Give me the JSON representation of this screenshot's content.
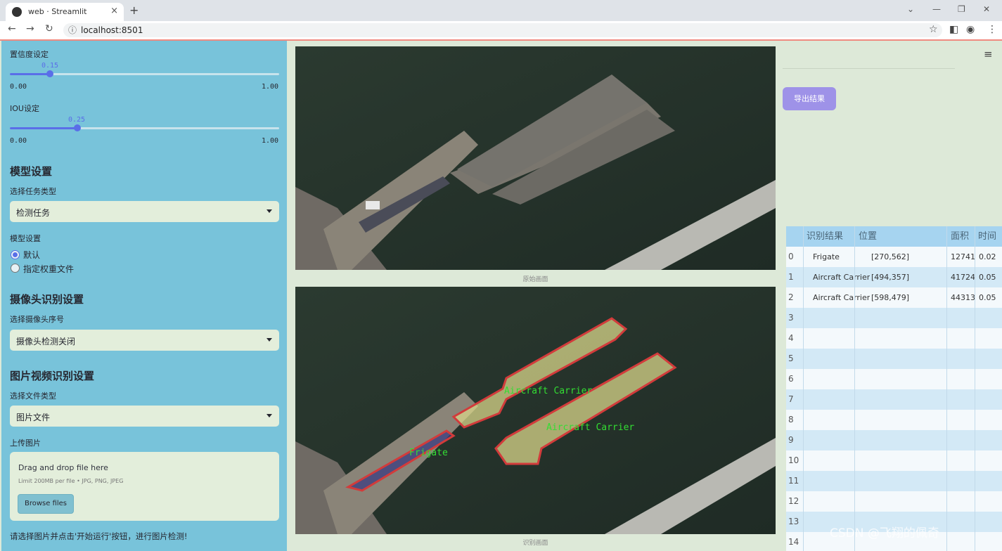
{
  "browser": {
    "tab_title": "web · Streamlit",
    "close_glyph": "×",
    "new_tab_glyph": "+",
    "url": "localhost:8501",
    "icons": [
      "back-icon",
      "forward-icon",
      "reload-icon",
      "info-icon",
      "star-icon",
      "side-panel-icon",
      "profile-icon",
      "menu-icon"
    ]
  },
  "sidebar": {
    "confidence": {
      "label": "置信度设定",
      "value": "0.15",
      "min": "0.00",
      "max": "1.00",
      "fraction": 0.15
    },
    "iou": {
      "label": "IOU设定",
      "value": "0.25",
      "min": "0.00",
      "max": "1.00",
      "fraction": 0.25
    },
    "model_heading": "模型设置",
    "task_label": "选择任务类型",
    "task_value": "检测任务",
    "weights_label": "模型设置",
    "weights_options": [
      "默认",
      "指定权重文件"
    ],
    "weights_selected": "默认",
    "camera_heading": "摄像头识别设置",
    "camera_label": "选择摄像头序号",
    "camera_value": "摄像头检测关闭",
    "media_heading": "图片视频识别设置",
    "filetype_label": "选择文件类型",
    "filetype_value": "图片文件",
    "upload_label": "上传图片",
    "upload_drag": "Drag and drop file here",
    "upload_limit": "Limit 200MB per file • JPG, PNG, JPEG",
    "browse_label": "Browse files",
    "hint": "请选择图片并点击'开始运行'按钮，进行图片检测!"
  },
  "main": {
    "original_caption": "原始画面",
    "result_caption": "识别画面",
    "detections": [
      {
        "label": "Frigate",
        "color": "#3a3c80"
      },
      {
        "label": "Aircraft Carrier",
        "color": "#d8d58a"
      },
      {
        "label": "Aircraft Carrier",
        "color": "#d8d58a"
      }
    ],
    "label_color": "#33dd33",
    "outline_color": "#d23b3b",
    "export_label": "导出结果",
    "menu_glyph": "≡"
  },
  "table": {
    "headers": [
      "识别结果",
      "位置",
      "面积",
      "时间"
    ],
    "rows": [
      {
        "idx": "0",
        "result": "Frigate",
        "position": "[270,562]",
        "area": "12741",
        "time": "0.02"
      },
      {
        "idx": "1",
        "result": "Aircraft Carrier",
        "position": "[494,357]",
        "area": "41724",
        "time": "0.05"
      },
      {
        "idx": "2",
        "result": "Aircraft Carrier",
        "position": "[598,479]",
        "area": "44313",
        "time": "0.05"
      },
      {
        "idx": "3",
        "result": "",
        "position": "",
        "area": "",
        "time": ""
      },
      {
        "idx": "4",
        "result": "",
        "position": "",
        "area": "",
        "time": ""
      },
      {
        "idx": "5",
        "result": "",
        "position": "",
        "area": "",
        "time": ""
      },
      {
        "idx": "6",
        "result": "",
        "position": "",
        "area": "",
        "time": ""
      },
      {
        "idx": "7",
        "result": "",
        "position": "",
        "area": "",
        "time": ""
      },
      {
        "idx": "8",
        "result": "",
        "position": "",
        "area": "",
        "time": ""
      },
      {
        "idx": "9",
        "result": "",
        "position": "",
        "area": "",
        "time": ""
      },
      {
        "idx": "10",
        "result": "",
        "position": "",
        "area": "",
        "time": ""
      },
      {
        "idx": "11",
        "result": "",
        "position": "",
        "area": "",
        "time": ""
      },
      {
        "idx": "12",
        "result": "",
        "position": "",
        "area": "",
        "time": ""
      },
      {
        "idx": "13",
        "result": "",
        "position": "",
        "area": "",
        "time": ""
      },
      {
        "idx": "14",
        "result": "",
        "position": "",
        "area": "",
        "time": ""
      }
    ]
  },
  "watermark": "CSDN @飞翔的佩奇"
}
